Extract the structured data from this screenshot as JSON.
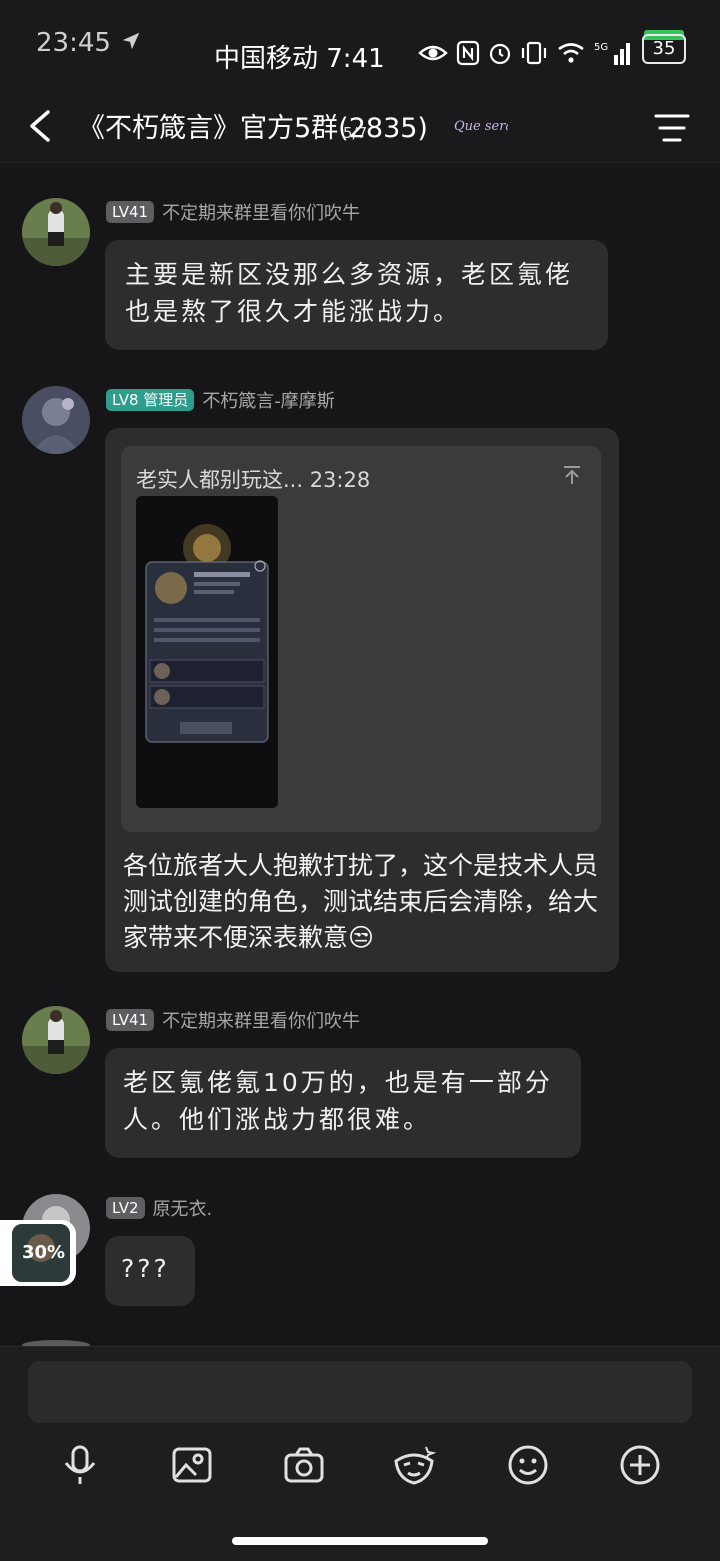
{
  "status_bar": {
    "time_left": "23:45",
    "carrier": "中国移动 7:41",
    "battery_level": "35",
    "network": "5G"
  },
  "header": {
    "title": "《不朽箴言》官方5群(2835)",
    "page_counter": "5/7",
    "logo_text": "Que sera"
  },
  "messages": [
    {
      "level": "LV41",
      "nickname": "不定期来群里看你们吹牛",
      "text": "主要是新区没那么多资源，老区氪佬也是熬了很久才能涨战力。"
    },
    {
      "level": "LV8",
      "role": "管理员",
      "nickname": "不朽箴言-摩摩斯",
      "quote_header": "老实人都别玩这... 23:28",
      "text": "各位旅者大人抱歉打扰了，这个是技术人员测试创建的角色，测试结束后会清除，给大家带来不便深表歉意",
      "emoji": "😒"
    },
    {
      "level": "LV41",
      "nickname": "不定期来群里看你们吹牛",
      "text": "老区氪佬氪10万的，也是有一部分人。他们涨战力都很难。"
    },
    {
      "level": "LV2",
      "nickname": "原无衣.",
      "text": "???"
    }
  ],
  "float_widget": {
    "label": "30%"
  },
  "colors": {
    "admin_badge": "#2e9e8c",
    "bubble": "#2d2d30",
    "background": "#161618",
    "battery": "#36c45a"
  },
  "toolbar_icons": [
    "mic-icon",
    "image-icon",
    "camera-icon",
    "sticker-icon",
    "emoji-icon",
    "plus-icon"
  ]
}
